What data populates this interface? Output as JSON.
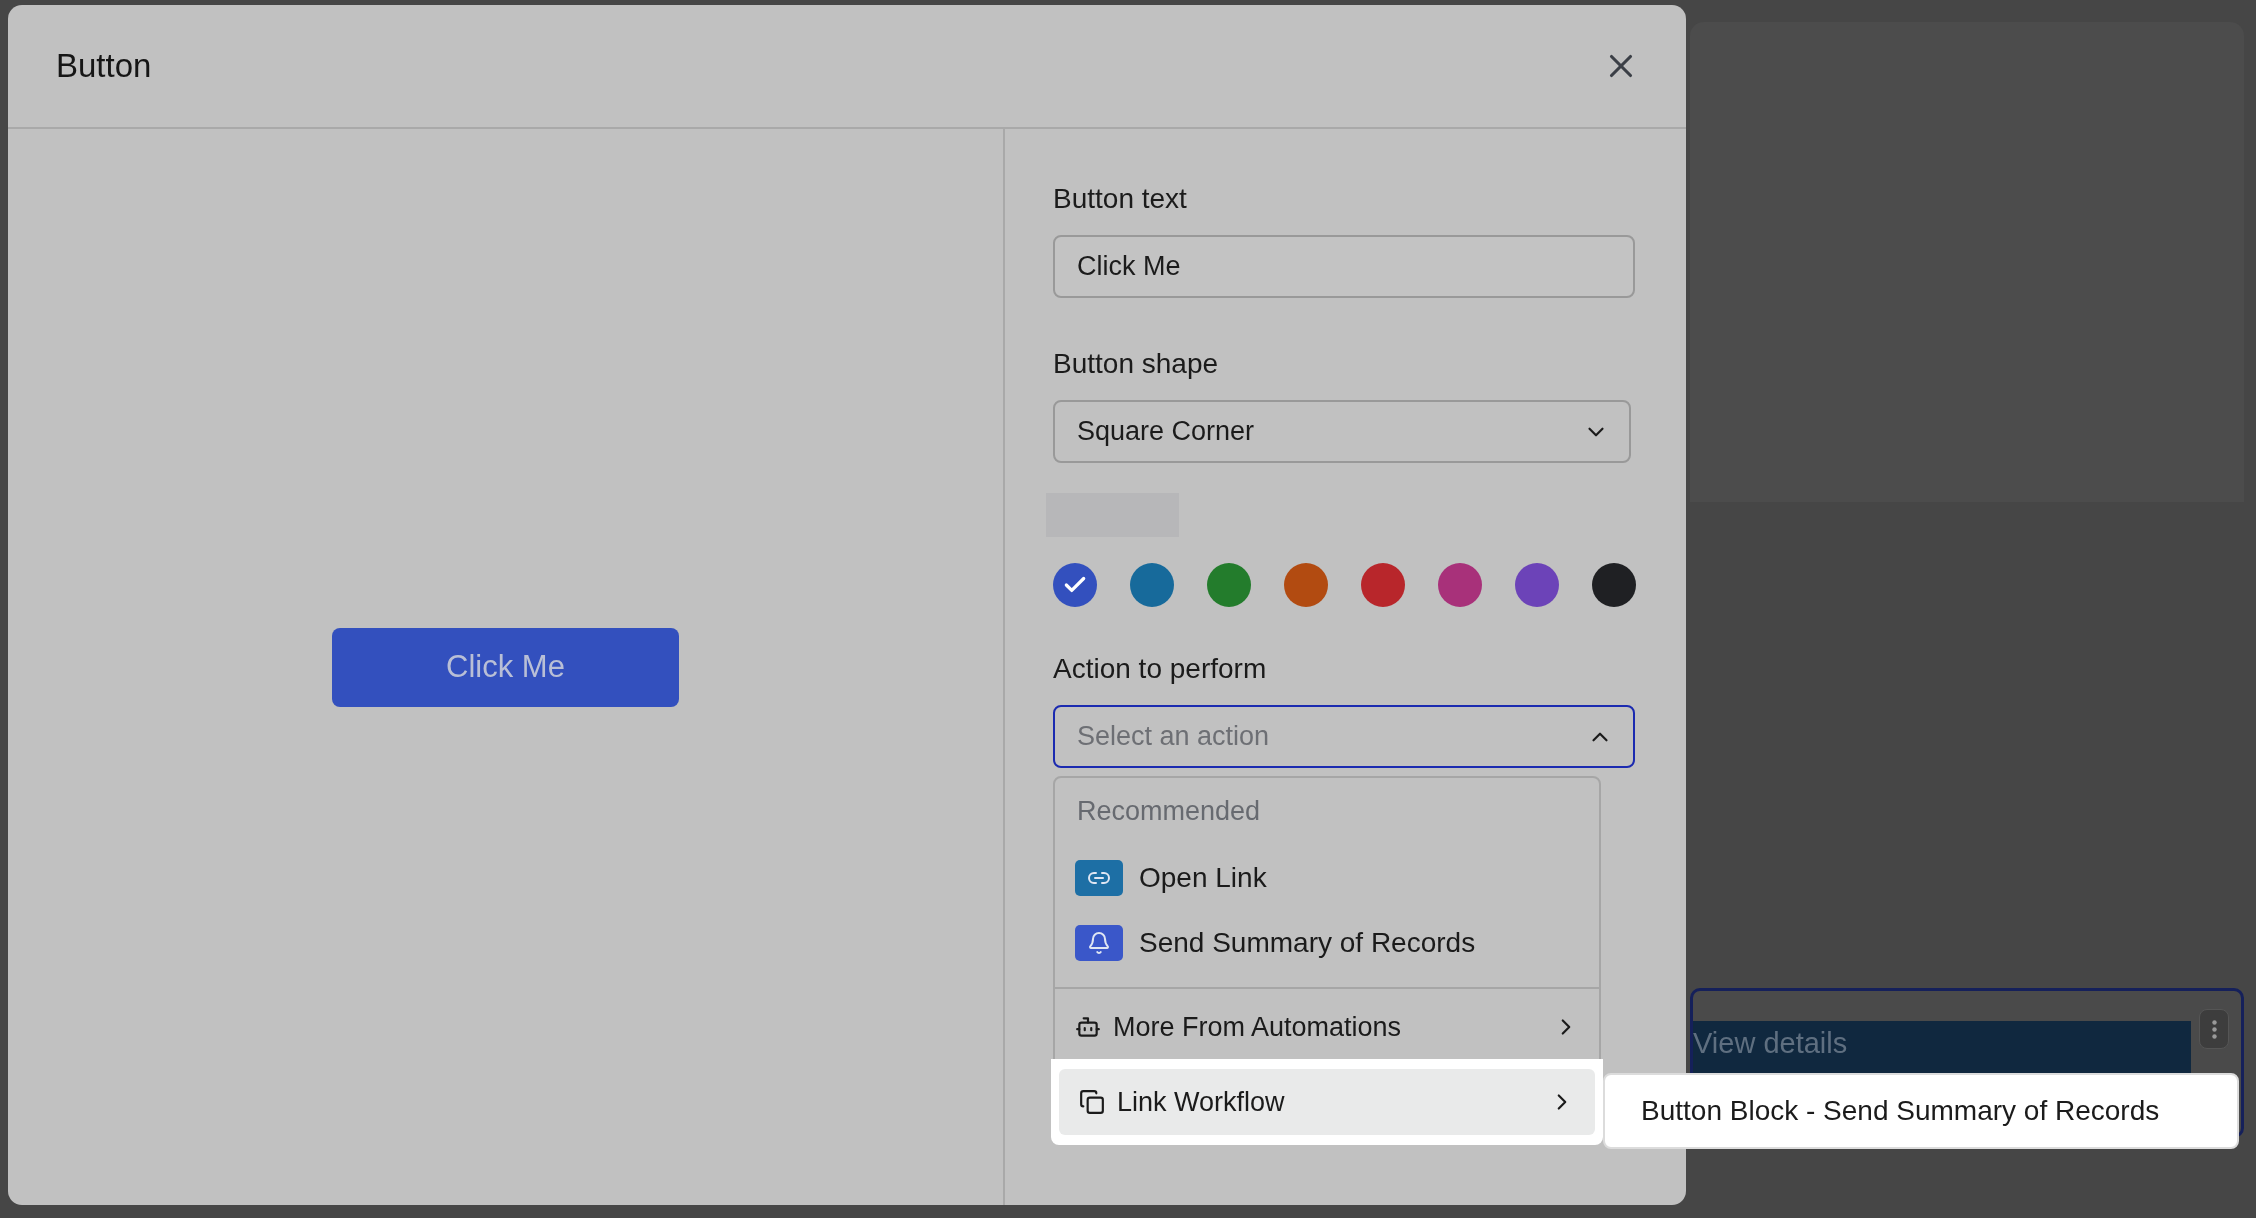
{
  "background": {
    "block_text": "View details"
  },
  "dialog": {
    "title": "Button",
    "preview_button": "Click Me",
    "button_text": {
      "label": "Button text",
      "value": "Click Me"
    },
    "button_shape": {
      "label": "Button shape",
      "value": "Square Corner",
      "expanded": false
    },
    "colors": [
      {
        "color": "#3350be",
        "selected": true
      },
      {
        "color": "#176a9b",
        "selected": false
      },
      {
        "color": "#237c2c",
        "selected": false
      },
      {
        "color": "#b24b11",
        "selected": false
      },
      {
        "color": "#b8262b",
        "selected": false
      },
      {
        "color": "#a8317a",
        "selected": false
      },
      {
        "color": "#6c43b8",
        "selected": false
      },
      {
        "color": "#1f2023",
        "selected": false
      }
    ],
    "action": {
      "label": "Action to perform",
      "placeholder": "Select an action",
      "expanded": true
    },
    "menu": {
      "section_title": "Recommended",
      "recommended": [
        {
          "label": "Open Link",
          "color": "#1d6fa5"
        },
        {
          "label": "Send Summary of Records",
          "color": "#3a57c9"
        }
      ],
      "more": [
        {
          "label": "More From Automations",
          "highlighted": false
        },
        {
          "label": "Link Workflow",
          "highlighted": true
        }
      ],
      "submenu": [
        "Button Block - Send Summary of Records"
      ]
    }
  }
}
